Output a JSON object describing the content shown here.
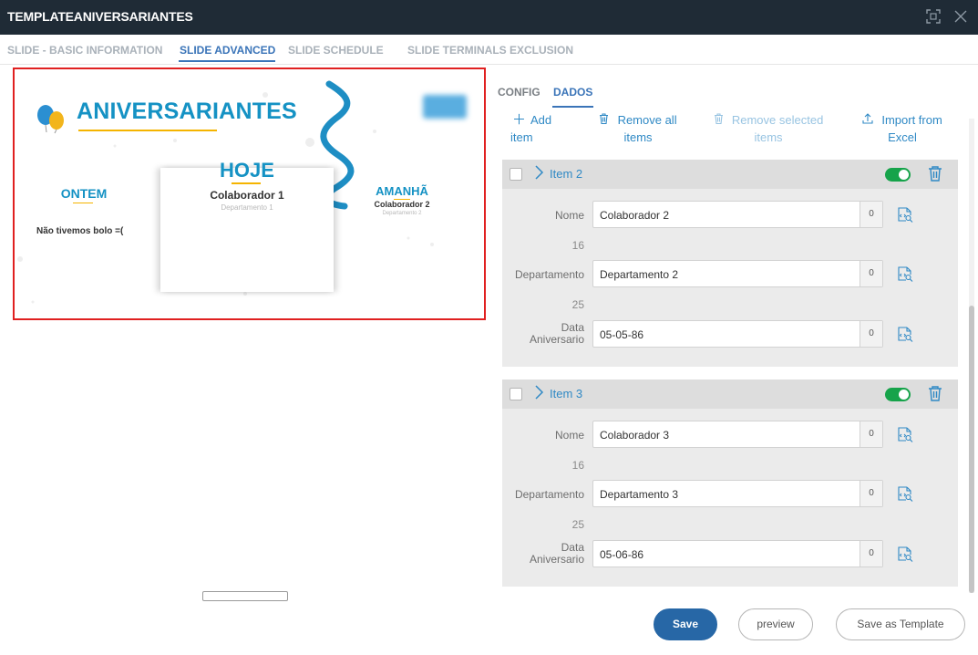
{
  "window": {
    "title": "TEMPLATEANIVERSARIANTES"
  },
  "tabs": [
    {
      "label": "SLIDE - BASIC INFORMATION"
    },
    {
      "label": "SLIDE ADVANCED",
      "active": true
    },
    {
      "label": "SLIDE SCHEDULE"
    },
    {
      "label": "SLIDE TERMINALS EXCLUSION"
    }
  ],
  "preview": {
    "title": "ANIVERSARIANTES",
    "yesterday": {
      "heading": "ONTEM",
      "text": "Não tivemos bolo =("
    },
    "today": {
      "heading": "HOJE",
      "name": "Colaborador 1",
      "department": "Departamento 1"
    },
    "tomorrow": {
      "heading": "AMANHÃ",
      "name": "Colaborador 2",
      "department": "Departamento 2"
    }
  },
  "subtabs": [
    {
      "label": "CONFIG"
    },
    {
      "label": "DADOS",
      "active": true
    }
  ],
  "actions": {
    "add": {
      "line1": "Add",
      "line2": "item"
    },
    "remove_all": {
      "line1": "Remove all",
      "line2": "items"
    },
    "remove_selected": {
      "line1": "Remove selected",
      "line2": "items"
    },
    "import": {
      "line1": "Import from",
      "line2": "Excel"
    }
  },
  "items": [
    {
      "title": "Item 2",
      "enabled": true,
      "fields": {
        "nome": {
          "label": "Nome",
          "value": "Colaborador 2",
          "count": "0",
          "max": "16"
        },
        "departamento": {
          "label": "Departamento",
          "value": "Departamento 2",
          "count": "0",
          "max": "25"
        },
        "data": {
          "label_line1": "Data",
          "label_line2": "Aniversario",
          "value": "05-05-86",
          "count": "0"
        }
      }
    },
    {
      "title": "Item 3",
      "enabled": true,
      "fields": {
        "nome": {
          "label": "Nome",
          "value": "Colaborador 3",
          "count": "0",
          "max": "16"
        },
        "departamento": {
          "label": "Departamento",
          "value": "Departamento 3",
          "count": "0",
          "max": "25"
        },
        "data": {
          "label_line1": "Data",
          "label_line2": "Aniversario",
          "value": "05-06-86",
          "count": "0"
        }
      }
    }
  ],
  "buttons": {
    "save": "Save",
    "preview": "preview",
    "save_template": "Save as Template"
  },
  "colors": {
    "accent": "#2f89c5",
    "primary": "#2767a6",
    "toggle_on": "#16a34a",
    "title_bar": "#1f2b36",
    "preview_border": "#e02020",
    "preview_title": "#1592c4"
  },
  "icons": {
    "maximize": "maximize-icon",
    "close": "close-icon",
    "add": "plus-icon",
    "trash": "trash-icon",
    "upload": "upload-icon",
    "lookup": "lookup-icon",
    "chevron": "chevron-right-icon"
  }
}
